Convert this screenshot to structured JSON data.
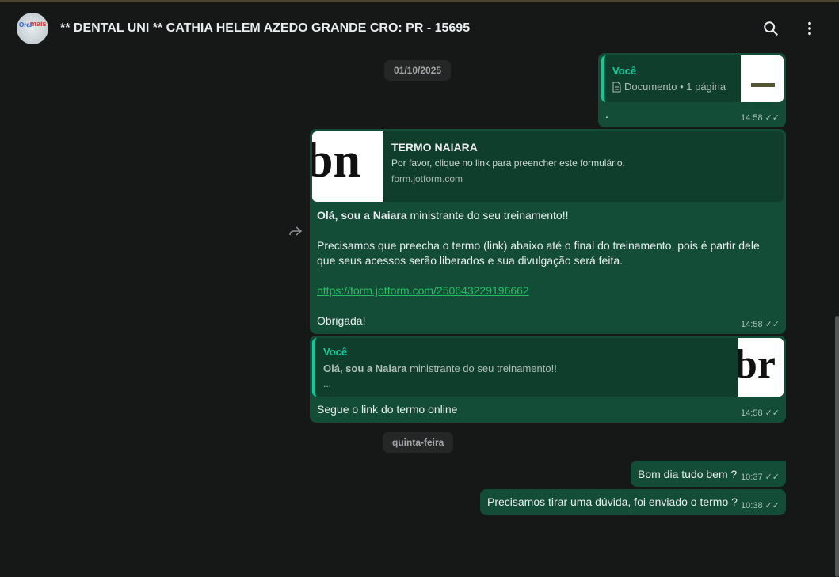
{
  "header": {
    "title": "** DENTAL UNI ** CATHIA HELEM AZEDO GRANDE CRO: PR - 15695",
    "avatar_text_1": "Oral",
    "avatar_text_2": "mais"
  },
  "dates": [
    "01/10/2025",
    "quinta-feira"
  ],
  "messages": [
    {
      "quote_sender": "Você",
      "doc_label": "Documento • 1 página",
      "text": ".",
      "time": "14:58"
    },
    {
      "preview_title": "TERMO NAIARA",
      "preview_desc": "Por favor, clique no link para preencher este formulário.",
      "preview_domain": "form.jotform.com",
      "text_bold": "Olá, sou a Naiara",
      "text_1": " ministrante do seu treinamento!!",
      "text_2": "Precisamos que preecha o termo (link) abaixo até o final do treinamento, pois é partir dele que seus acessos serão liberados e sua divulgação será feita.",
      "link": "https://form.jotform.com/250643229196662",
      "text_3": "Obrigada!",
      "time": "14:58"
    },
    {
      "quote_sender": "Você",
      "quote_bold": "Olá, sou a Naiara",
      "quote_text": " ministrante do seu treinamento!!",
      "quote_more": "...",
      "text": "Segue o link do termo online",
      "time": "14:58"
    },
    {
      "text": "Bom dia tudo bem ?",
      "time": "10:37"
    },
    {
      "text": "Precisamos tirar uma dúvida, foi enviado o termo ?",
      "time": "10:38"
    }
  ]
}
